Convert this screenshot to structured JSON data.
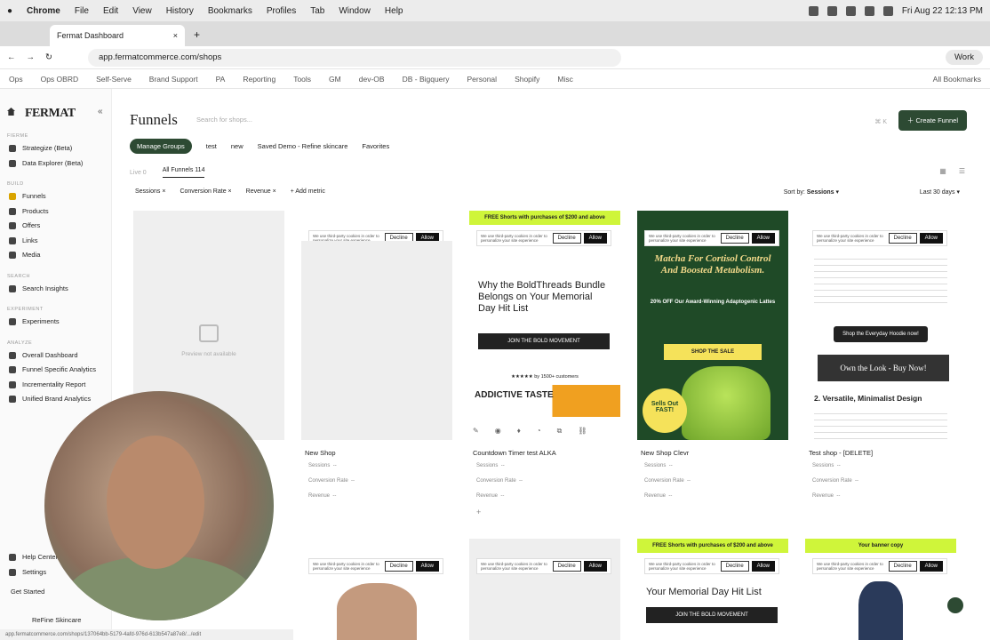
{
  "menubar": {
    "apple": "",
    "app": "Chrome",
    "items": [
      "File",
      "Edit",
      "View",
      "History",
      "Bookmarks",
      "Profiles",
      "Tab",
      "Window",
      "Help"
    ],
    "clock": "Fri Aug 22  12:13 PM"
  },
  "tab": {
    "title": "Fermat Dashboard",
    "close": "×",
    "new": "+"
  },
  "address": {
    "url": "app.fermatcommerce.com/shops",
    "profile": "Work"
  },
  "bookmarks": {
    "items": [
      "Ops",
      "Ops OBRD",
      "Self-Serve",
      "Brand Support",
      "PA",
      "Reporting",
      "Tools",
      "GM",
      "dev-OB",
      "DB - Bigquery",
      "Personal",
      "Shopify",
      "Misc"
    ],
    "all": "All Bookmarks"
  },
  "sidebar": {
    "logo": "FERMAT",
    "collapse": "«",
    "sections": {
      "fierme": "FIERME",
      "build": "BUILD",
      "search": "SEARCH",
      "experiment": "EXPERIMENT",
      "analyze": "ANALYZE"
    },
    "strategize": "Strategize (Beta)",
    "explorer": "Data Explorer (Beta)",
    "funnels": "Funnels",
    "products": "Products",
    "offers": "Offers",
    "links": "Links",
    "media": "Media",
    "insights": "Search Insights",
    "experiments": "Experiments",
    "overall": "Overall Dashboard",
    "funnel_specific": "Funnel Specific Analytics",
    "incrementality": "Incrementality Report",
    "unified": "Unified Brand Analytics",
    "help": "Help Center",
    "settings": "Settings",
    "started": "Get Started",
    "shop": "ReFine Skincare"
  },
  "header": {
    "title": "Funnels",
    "search_placeholder": "Search for shops...",
    "create": "Create Funnel",
    "shortcut": "⌘ K"
  },
  "groups": {
    "manage": "Manage Groups",
    "items": [
      "test",
      "new",
      "Saved Demo - Refine skincare",
      "Favorites"
    ]
  },
  "filters": {
    "live": "Live",
    "live_count": "0",
    "all": "All Funnels",
    "all_count": "114"
  },
  "metrics": {
    "items": [
      "Sessions",
      "Conversion Rate",
      "Revenue"
    ],
    "add": "+ Add metric",
    "sort_label": "Sort by:",
    "sort_value": "Sessions",
    "range": "Last 30 days"
  },
  "cookie": {
    "text": "We use third-party cookies in order to personalize your site experience",
    "decline": "Decline",
    "allow": "Allow"
  },
  "cards": [
    {
      "name": "",
      "preview": "Preview not available"
    },
    {
      "name": "New Shop"
    },
    {
      "name": "Countdown Timer test ALKA",
      "promo": "FREE Shorts with purchases of $200 and above",
      "headline": "Why the BoldThreads Bundle Belongs on Your Memorial Day Hit List",
      "cta": "JOIN THE BOLD MOVEMENT",
      "rating": "by 1500+ customers",
      "addictive": "ADDICTIVE TASTE"
    },
    {
      "name": "New Shop Clevr",
      "headline": "Matcha For Cortisol Control And Boosted Metabolism.",
      "offer": "20% OFF Our Award-Winning Adaptogenic Lattes",
      "cta": "SHOP THE SALE",
      "badge": "Sells Out FAST!"
    },
    {
      "name": "Test shop - [DELETE]",
      "cta": "Shop the Everyday Hoodie now!",
      "cta2": "Own the Look - Buy Now!",
      "section": "2. Versatile, Minimalist Design"
    }
  ],
  "card_metrics": {
    "sessions": "Sessions",
    "conv": "Conversion Rate",
    "revenue": "Revenue",
    "dash": "--"
  },
  "row2": {
    "promo": "FREE Shorts with purchases of $200 and above",
    "headline": "Your Memorial Day Hit List",
    "cta": "JOIN THE BOLD MOVEMENT",
    "banner": "Your banner copy"
  },
  "status": "app.fermatcommerce.com/shops/137064bb-5179-4afd-976d-613b547a87e8/.../edit"
}
